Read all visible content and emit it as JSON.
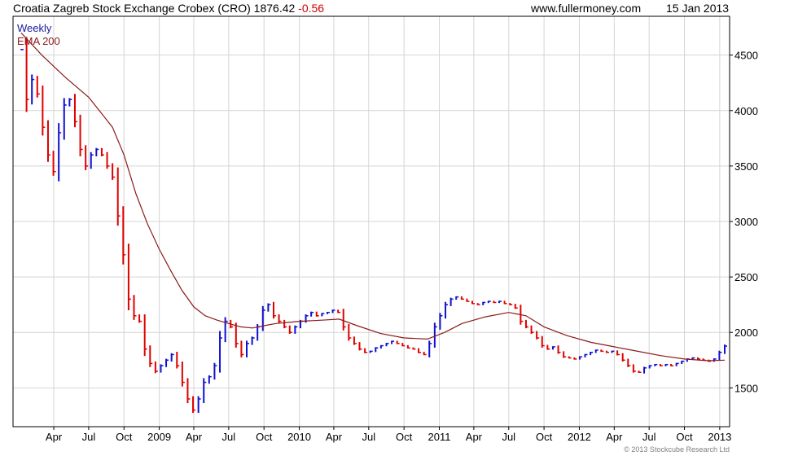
{
  "header": {
    "title": "Croatia Zagreb Stock Exchange Crobex (CRO) 1876.42",
    "change": "-0.56",
    "site": "www.fullermoney.com",
    "date": "15 Jan 2013"
  },
  "legend": {
    "weekly": "Weekly",
    "ema": "EMA 200"
  },
  "copyright": "© 2013 Stockcube Research Ltd",
  "colors": {
    "up": "#1010d0",
    "down": "#e00000",
    "ema": "#8b1a1a",
    "grid": "#d4d4d4"
  },
  "chart_data": {
    "type": "line",
    "subtype": "candlestick",
    "title": "",
    "xlabel": "",
    "ylabel": "",
    "ylim": [
      1150,
      4850
    ],
    "yticks": [
      1500,
      2000,
      2500,
      3000,
      3500,
      4000,
      4500
    ],
    "ytick_labels": [
      "1500",
      "2000",
      "2500",
      "3000",
      "3500",
      "4000",
      "4500"
    ],
    "y_axis_side": "right",
    "grid": true,
    "legend_position": "top-left",
    "x_range": [
      "2008-01-07",
      "2013-01-14"
    ],
    "xticks": [
      {
        "date": "2008-04-01",
        "label": "Apr"
      },
      {
        "date": "2008-07-01",
        "label": "Jul"
      },
      {
        "date": "2008-10-01",
        "label": "Oct"
      },
      {
        "date": "2009-01-01",
        "label": "2009"
      },
      {
        "date": "2009-04-01",
        "label": "Apr"
      },
      {
        "date": "2009-07-01",
        "label": "Jul"
      },
      {
        "date": "2009-10-01",
        "label": "Oct"
      },
      {
        "date": "2010-01-01",
        "label": "2010"
      },
      {
        "date": "2010-04-01",
        "label": "Apr"
      },
      {
        "date": "2010-07-01",
        "label": "Jul"
      },
      {
        "date": "2010-10-01",
        "label": "Oct"
      },
      {
        "date": "2011-01-01",
        "label": "2011"
      },
      {
        "date": "2011-04-01",
        "label": "Apr"
      },
      {
        "date": "2011-07-01",
        "label": "Jul"
      },
      {
        "date": "2011-10-01",
        "label": "Oct"
      },
      {
        "date": "2012-01-01",
        "label": "2012"
      },
      {
        "date": "2012-04-01",
        "label": "Apr"
      },
      {
        "date": "2012-07-01",
        "label": "Jul"
      },
      {
        "date": "2012-10-01",
        "label": "Oct"
      },
      {
        "date": "2013-01-01",
        "label": "2013"
      }
    ],
    "series": [
      {
        "name": "Weekly",
        "type": "close",
        "points": [
          [
            "2008-01-07",
            4550
          ],
          [
            "2008-01-21",
            4100
          ],
          [
            "2008-02-04",
            4280
          ],
          [
            "2008-02-18",
            4150
          ],
          [
            "2008-03-03",
            3850
          ],
          [
            "2008-03-17",
            3600
          ],
          [
            "2008-03-31",
            3450
          ],
          [
            "2008-04-14",
            3800
          ],
          [
            "2008-04-28",
            4050
          ],
          [
            "2008-05-12",
            4100
          ],
          [
            "2008-05-26",
            3900
          ],
          [
            "2008-06-09",
            3650
          ],
          [
            "2008-06-23",
            3500
          ],
          [
            "2008-07-07",
            3600
          ],
          [
            "2008-07-21",
            3650
          ],
          [
            "2008-08-04",
            3600
          ],
          [
            "2008-08-18",
            3500
          ],
          [
            "2008-09-01",
            3400
          ],
          [
            "2008-09-15",
            3050
          ],
          [
            "2008-09-29",
            2700
          ],
          [
            "2008-10-13",
            2300
          ],
          [
            "2008-10-27",
            2150
          ],
          [
            "2008-11-10",
            2100
          ],
          [
            "2008-11-24",
            1850
          ],
          [
            "2008-12-08",
            1720
          ],
          [
            "2008-12-22",
            1650
          ],
          [
            "2009-01-05",
            1700
          ],
          [
            "2009-01-19",
            1750
          ],
          [
            "2009-02-02",
            1800
          ],
          [
            "2009-02-16",
            1700
          ],
          [
            "2009-03-02",
            1550
          ],
          [
            "2009-03-16",
            1400
          ],
          [
            "2009-03-30",
            1300
          ],
          [
            "2009-04-13",
            1400
          ],
          [
            "2009-04-27",
            1550
          ],
          [
            "2009-05-11",
            1600
          ],
          [
            "2009-05-25",
            1700
          ],
          [
            "2009-06-08",
            1950
          ],
          [
            "2009-06-22",
            2100
          ],
          [
            "2009-07-06",
            2050
          ],
          [
            "2009-07-20",
            1900
          ],
          [
            "2009-08-03",
            1800
          ],
          [
            "2009-08-17",
            1900
          ],
          [
            "2009-08-31",
            1950
          ],
          [
            "2009-09-14",
            2050
          ],
          [
            "2009-09-28",
            2200
          ],
          [
            "2009-10-12",
            2250
          ],
          [
            "2009-10-26",
            2150
          ],
          [
            "2009-11-09",
            2100
          ],
          [
            "2009-11-23",
            2050
          ],
          [
            "2009-12-07",
            2000
          ],
          [
            "2009-12-21",
            2050
          ],
          [
            "2010-01-04",
            2100
          ],
          [
            "2010-01-18",
            2150
          ],
          [
            "2010-02-01",
            2180
          ],
          [
            "2010-02-15",
            2150
          ],
          [
            "2010-03-01",
            2170
          ],
          [
            "2010-03-15",
            2180
          ],
          [
            "2010-03-29",
            2200
          ],
          [
            "2010-04-12",
            2180
          ],
          [
            "2010-04-26",
            2050
          ],
          [
            "2010-05-10",
            1950
          ],
          [
            "2010-05-24",
            1900
          ],
          [
            "2010-06-07",
            1850
          ],
          [
            "2010-06-21",
            1820
          ],
          [
            "2010-07-05",
            1830
          ],
          [
            "2010-07-19",
            1860
          ],
          [
            "2010-08-02",
            1880
          ],
          [
            "2010-08-16",
            1900
          ],
          [
            "2010-08-30",
            1920
          ],
          [
            "2010-09-13",
            1900
          ],
          [
            "2010-09-27",
            1880
          ],
          [
            "2010-10-11",
            1860
          ],
          [
            "2010-10-25",
            1850
          ],
          [
            "2010-11-08",
            1820
          ],
          [
            "2010-11-22",
            1800
          ],
          [
            "2010-12-06",
            1900
          ],
          [
            "2010-12-20",
            2050
          ],
          [
            "2011-01-03",
            2150
          ],
          [
            "2011-01-17",
            2250
          ],
          [
            "2011-01-31",
            2300
          ],
          [
            "2011-02-14",
            2320
          ],
          [
            "2011-02-28",
            2300
          ],
          [
            "2011-03-14",
            2280
          ],
          [
            "2011-03-28",
            2260
          ],
          [
            "2011-04-11",
            2250
          ],
          [
            "2011-04-25",
            2270
          ],
          [
            "2011-05-09",
            2280
          ],
          [
            "2011-05-23",
            2270
          ],
          [
            "2011-06-06",
            2280
          ],
          [
            "2011-06-20",
            2260
          ],
          [
            "2011-07-04",
            2250
          ],
          [
            "2011-07-18",
            2220
          ],
          [
            "2011-08-01",
            2100
          ],
          [
            "2011-08-15",
            2050
          ],
          [
            "2011-08-29",
            2000
          ],
          [
            "2011-09-12",
            1950
          ],
          [
            "2011-09-26",
            1880
          ],
          [
            "2011-10-10",
            1850
          ],
          [
            "2011-10-24",
            1870
          ],
          [
            "2011-11-07",
            1820
          ],
          [
            "2011-11-21",
            1780
          ],
          [
            "2011-12-05",
            1770
          ],
          [
            "2011-12-19",
            1760
          ],
          [
            "2012-01-02",
            1780
          ],
          [
            "2012-01-16",
            1800
          ],
          [
            "2012-01-30",
            1820
          ],
          [
            "2012-02-13",
            1840
          ],
          [
            "2012-02-27",
            1830
          ],
          [
            "2012-03-12",
            1820
          ],
          [
            "2012-03-26",
            1830
          ],
          [
            "2012-04-09",
            1800
          ],
          [
            "2012-04-23",
            1750
          ],
          [
            "2012-05-07",
            1700
          ],
          [
            "2012-05-21",
            1650
          ],
          [
            "2012-06-04",
            1640
          ],
          [
            "2012-06-18",
            1680
          ],
          [
            "2012-07-02",
            1700
          ],
          [
            "2012-07-16",
            1710
          ],
          [
            "2012-07-30",
            1700
          ],
          [
            "2012-08-13",
            1710
          ],
          [
            "2012-08-27",
            1700
          ],
          [
            "2012-09-10",
            1720
          ],
          [
            "2012-09-24",
            1740
          ],
          [
            "2012-10-08",
            1760
          ],
          [
            "2012-10-22",
            1770
          ],
          [
            "2012-11-05",
            1760
          ],
          [
            "2012-11-19",
            1750
          ],
          [
            "2012-12-03",
            1740
          ],
          [
            "2012-12-17",
            1760
          ],
          [
            "2012-12-31",
            1820
          ],
          [
            "2013-01-14",
            1876.42
          ]
        ]
      },
      {
        "name": "EMA 200",
        "type": "line",
        "points": [
          [
            "2008-01-07",
            4700
          ],
          [
            "2008-03-01",
            4500
          ],
          [
            "2008-05-01",
            4300
          ],
          [
            "2008-07-01",
            4120
          ],
          [
            "2008-09-01",
            3850
          ],
          [
            "2008-10-01",
            3600
          ],
          [
            "2008-11-01",
            3250
          ],
          [
            "2008-12-01",
            2980
          ],
          [
            "2009-01-01",
            2750
          ],
          [
            "2009-02-01",
            2550
          ],
          [
            "2009-03-01",
            2380
          ],
          [
            "2009-04-01",
            2230
          ],
          [
            "2009-05-01",
            2150
          ],
          [
            "2009-06-01",
            2110
          ],
          [
            "2009-07-01",
            2080
          ],
          [
            "2009-08-01",
            2050
          ],
          [
            "2009-09-01",
            2040
          ],
          [
            "2009-10-01",
            2060
          ],
          [
            "2009-11-01",
            2080
          ],
          [
            "2009-12-01",
            2090
          ],
          [
            "2010-01-01",
            2100
          ],
          [
            "2010-03-01",
            2110
          ],
          [
            "2010-04-15",
            2120
          ],
          [
            "2010-06-01",
            2060
          ],
          [
            "2010-08-01",
            1990
          ],
          [
            "2010-10-01",
            1950
          ],
          [
            "2010-12-01",
            1940
          ],
          [
            "2011-01-15",
            2000
          ],
          [
            "2011-03-01",
            2080
          ],
          [
            "2011-05-01",
            2140
          ],
          [
            "2011-07-01",
            2180
          ],
          [
            "2011-08-15",
            2150
          ],
          [
            "2011-10-01",
            2050
          ],
          [
            "2011-12-01",
            1970
          ],
          [
            "2012-02-01",
            1910
          ],
          [
            "2012-04-01",
            1870
          ],
          [
            "2012-06-01",
            1830
          ],
          [
            "2012-08-01",
            1790
          ],
          [
            "2012-10-01",
            1760
          ],
          [
            "2012-12-01",
            1745
          ],
          [
            "2013-01-14",
            1750
          ]
        ]
      }
    ]
  }
}
